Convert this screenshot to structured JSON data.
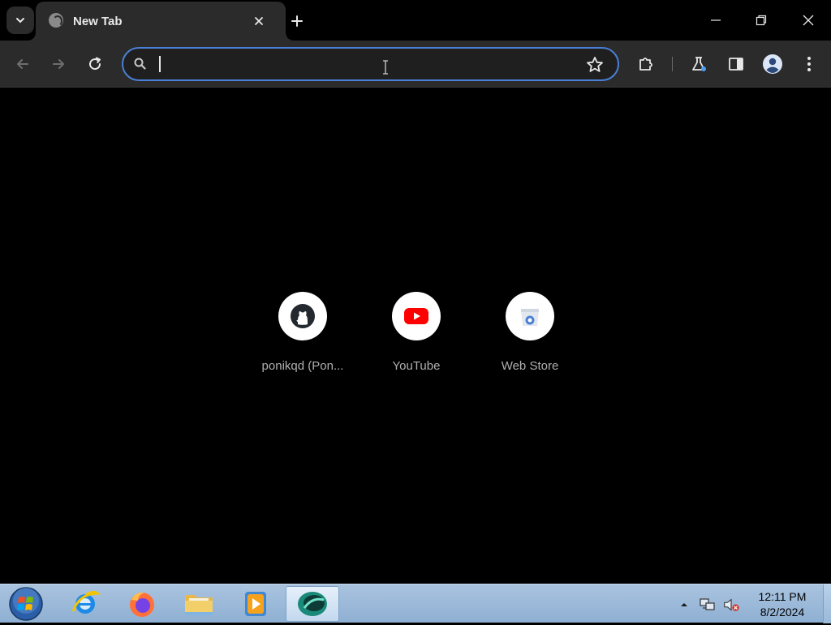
{
  "browser": {
    "tab": {
      "title": "New Tab",
      "favicon": "globe-icon"
    },
    "window_controls": [
      "minimize-icon",
      "restore-icon",
      "close-icon"
    ],
    "omnibox": {
      "value": "",
      "placeholder": ""
    },
    "accent_color": "#4a7fd6"
  },
  "shortcuts": [
    {
      "label": "ponikqd (Pon...",
      "icon": "github-icon"
    },
    {
      "label": "YouTube",
      "icon": "youtube-icon"
    },
    {
      "label": "Web Store",
      "icon": "web-store-icon"
    }
  ],
  "taskbar": {
    "apps": [
      "internet-explorer-icon",
      "firefox-icon",
      "file-explorer-icon",
      "media-player-icon",
      "chrome-icon"
    ],
    "clock": {
      "time": "12:11 PM",
      "date": "8/2/2024"
    }
  }
}
